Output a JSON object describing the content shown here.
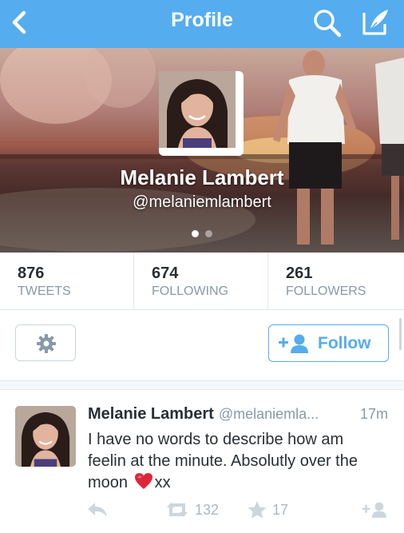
{
  "navbar": {
    "title": "Profile",
    "background": "#55acee",
    "icons": [
      "back-chevron-icon",
      "search-icon",
      "compose-icon"
    ]
  },
  "profile": {
    "name": "Melanie Lambert",
    "handle": "@melaniemlambert",
    "pager": {
      "pages": 2,
      "active": 1
    }
  },
  "stats": [
    {
      "count": "876",
      "label": "TWEETS"
    },
    {
      "count": "674",
      "label": "FOLLOWING"
    },
    {
      "count": "261",
      "label": "FOLLOWERS"
    }
  ],
  "actions": {
    "settings_icon": "gear-icon",
    "follow_label": "Follow",
    "follow_icon": "add-user-icon",
    "accent": "#55acee"
  },
  "tweet": {
    "name": "Melanie Lambert",
    "handle": "@melaniemla...",
    "time": "17m",
    "text_before_emoji": "I have no words to describe how am feelin at the minute. Absolutly over the moon",
    "emoji": "red-heart-icon",
    "text_after_emoji": "xx",
    "retweets": "132",
    "favorites": "17"
  }
}
